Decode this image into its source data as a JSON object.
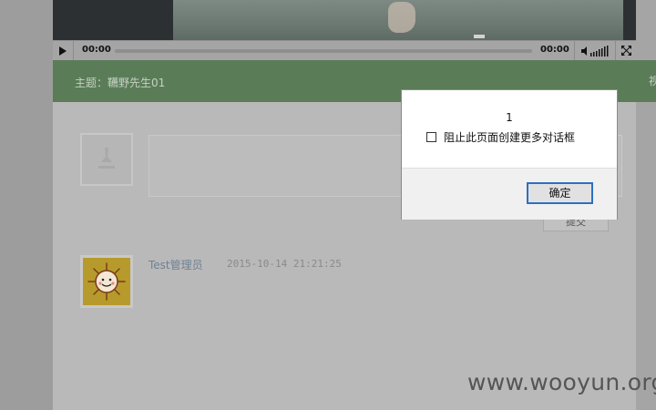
{
  "player": {
    "current_time": "00:00",
    "duration": "00:00",
    "progress": 0
  },
  "topic": {
    "title": "主题：韉野先生01",
    "right_cut_text": "视"
  },
  "comment_form": {
    "submit_label": "提交"
  },
  "comment": {
    "username": "Test管理员",
    "timestamp": "2015-10-14 21:21:25"
  },
  "watermark": "www.wooyun.org",
  "dialog": {
    "message": "1",
    "checkbox_label": "阻止此页面创建更多对话框",
    "checkbox_checked": false,
    "ok_label": "确定"
  },
  "colors": {
    "topic_bar": "#5a7d57",
    "dialog_ok_border": "#2d6fc0"
  }
}
